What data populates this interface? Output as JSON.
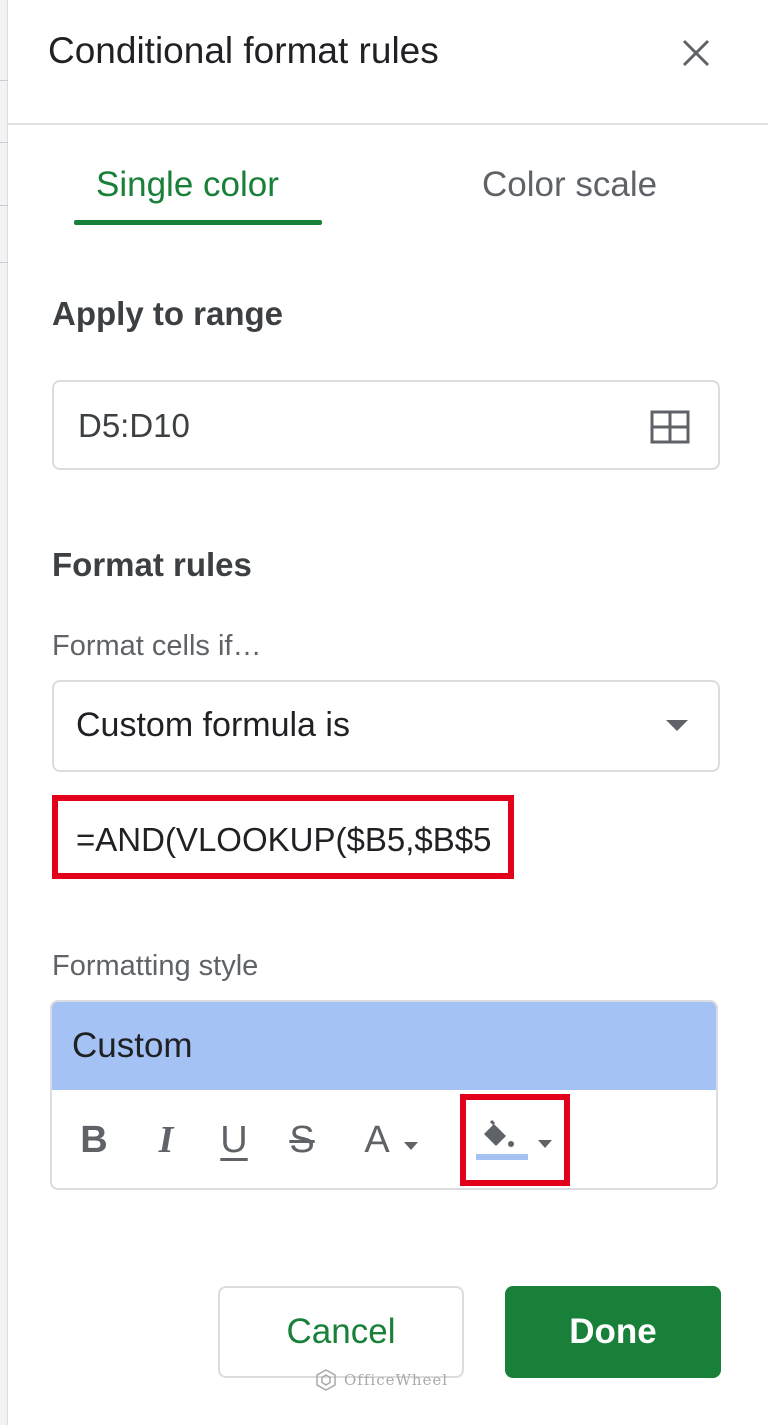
{
  "dialog": {
    "title": "Conditional format rules",
    "close_icon": "close-icon"
  },
  "tabs": [
    {
      "label": "Single color",
      "active": true
    },
    {
      "label": "Color scale",
      "active": false
    }
  ],
  "apply_to_range": {
    "label": "Apply to range",
    "value": "D5:D10",
    "icon": "grid-select-icon"
  },
  "format_rules": {
    "label": "Format rules",
    "condition_label": "Format cells if…",
    "condition_value": "Custom formula is",
    "formula_value": "=AND(VLOOKUP($B5,$B$5"
  },
  "formatting_style": {
    "label": "Formatting style",
    "preview_label": "Custom",
    "preview_color": "#a4c2f4",
    "tools": [
      {
        "name": "bold-icon",
        "glyph": "B"
      },
      {
        "name": "italic-icon",
        "glyph": "I"
      },
      {
        "name": "underline-icon",
        "glyph": "U"
      },
      {
        "name": "strikethrough-icon",
        "glyph": "S"
      },
      {
        "name": "text-color-icon",
        "glyph": "A"
      },
      {
        "name": "fill-color-icon"
      }
    ]
  },
  "actions": {
    "cancel_label": "Cancel",
    "done_label": "Done"
  },
  "watermark": {
    "text": "OfficeWheel"
  },
  "colors": {
    "accent": "#188038",
    "highlight": "#e3001b",
    "fill_color_swatch": "#a4c2f4"
  }
}
